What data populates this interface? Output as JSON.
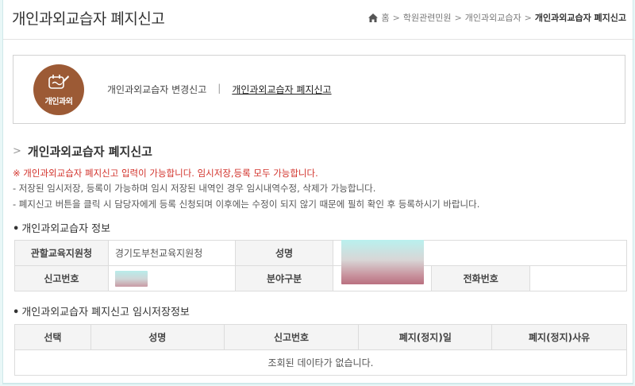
{
  "header": {
    "title": "개인과외교습자 폐지신고",
    "breadcrumb": [
      "홈",
      "학원관련민원",
      "개인과외교습자",
      "개인과외교습자 폐지신고"
    ]
  },
  "badge": {
    "label": "개인과외",
    "color": "#9c5a35"
  },
  "tabs": {
    "change_label": "개인과외교습자 변경신고",
    "divider": "|",
    "close_label": "개인과외교습자 폐지신고"
  },
  "section": {
    "title": "개인과외교습자 폐지신고",
    "notice_red": "※ 개인과외교습자 폐지신고 입력이 가능합니다. 임시저장,등록 모두 가능합니다.",
    "notice_1": "- 저장된 임시저장, 등록이 가능하며 임시 저장된 내역인 경우 임시내역수정, 삭제가 가능합니다.",
    "notice_2": "- 폐지신고 버튼을 클릭 시 담당자에게 등록 신청되며 이후에는 수정이 되지 않기 때문에 필히 확인 후 등록하시기 바랍니다."
  },
  "info": {
    "heading": "개인과외교습자 정보",
    "labels": {
      "office": "관할교육지원청",
      "name": "성명",
      "report_no": "신고번호",
      "field": "분야구분",
      "phone": "전화번호"
    },
    "values": {
      "office": "경기도부천교육지원청",
      "phone": ""
    }
  },
  "temp": {
    "heading": "개인과외교습자 폐지신고 임시저장정보",
    "columns": [
      "선택",
      "성명",
      "신고번호",
      "폐지(정지)일",
      "폐지(정지)사유"
    ],
    "empty_message": "조회된 데이타가 없습니다."
  }
}
